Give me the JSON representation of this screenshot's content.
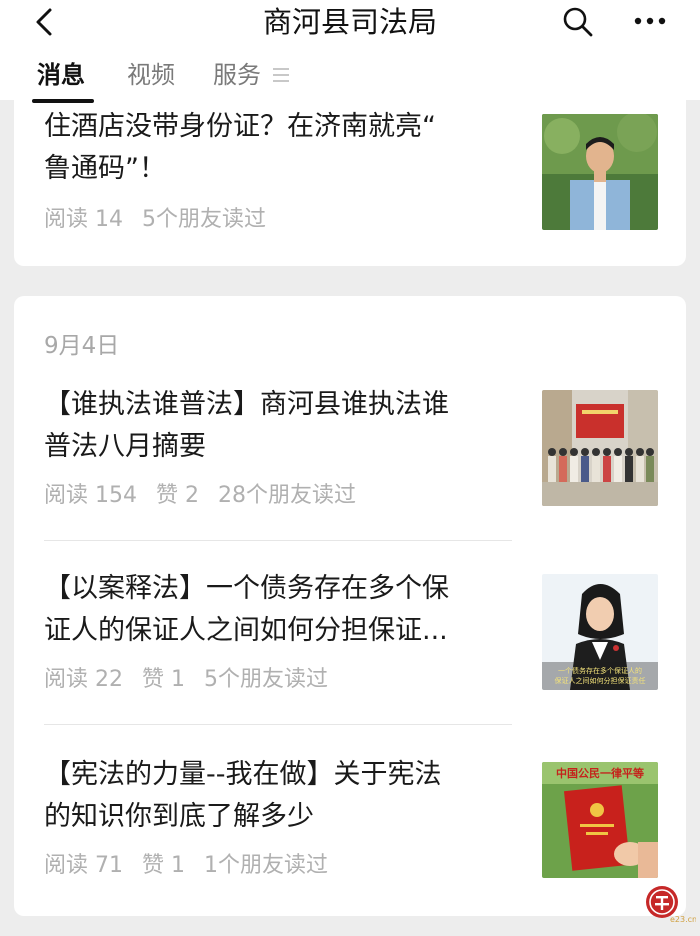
{
  "header": {
    "title": "商河县司法局",
    "back_icon": "chevron-left-icon",
    "search_icon": "search-icon",
    "more_icon": "more-icon"
  },
  "tabs": [
    {
      "label": "消息",
      "active": true
    },
    {
      "label": "视频",
      "active": false
    },
    {
      "label": "服务",
      "active": false
    }
  ],
  "feed": {
    "first_article": {
      "title_line1": "住酒店没带身份证？在济南就亮“",
      "title_line2": "鲁通码”！",
      "reads": "阅读 14",
      "friends": "5个朋友读过"
    },
    "group": {
      "date": "9月4日",
      "articles": [
        {
          "title_line1": "【谁执法谁普法】商河县谁执法谁",
          "title_line2": "普法八月摘要",
          "reads": "阅读 154",
          "likes": "赞 2",
          "friends": "28个朋友读过"
        },
        {
          "title_line1": "【以案释法】一个债务存在多个保",
          "title_line2": "证人的保证人之间如何分担保证...",
          "reads": "阅读 22",
          "likes": "赞 1",
          "friends": "5个朋友读过",
          "thumb_caption_line1": "一个债务存在多个保证人的",
          "thumb_caption_line2": "保证人之间如何分担保证责任"
        },
        {
          "title_line1": "【宪法的力量--我在做】关于宪法",
          "title_line2": "的知识你到底了解多少",
          "reads": "阅读 71",
          "likes": "赞 1",
          "friends": "1个朋友读过",
          "thumb_caption": "中国公民一律平等"
        }
      ]
    }
  },
  "watermark": {
    "text": "e23.cn"
  }
}
